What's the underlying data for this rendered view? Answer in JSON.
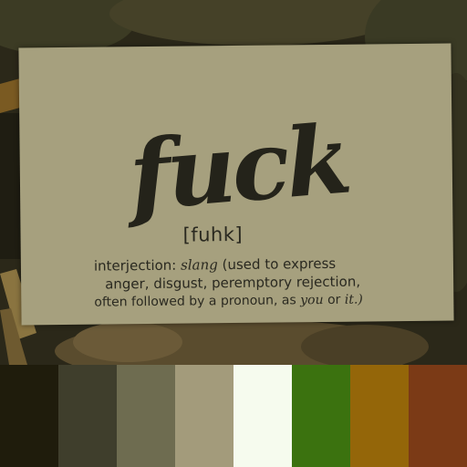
{
  "card": {
    "word": "fuck",
    "pronunciation": "[fuhk]",
    "pos": "interjection:",
    "usage_label": "slang",
    "line1_rest": "(used to express",
    "line2": "anger, disgust, peremptory rejection,",
    "line3_start": "often followed by a pronoun, as",
    "example1": "you",
    "connector": "or",
    "example2": "it.)"
  },
  "palette": [
    "#1f1c0c",
    "#3f3e2c",
    "#6e6c50",
    "#a39b7b",
    "#f6fbee",
    "#3b720f",
    "#946609",
    "#7b3a16"
  ],
  "colors": {
    "card": "#a6a07e",
    "ink": "#24231a",
    "background": "#2a2718"
  }
}
